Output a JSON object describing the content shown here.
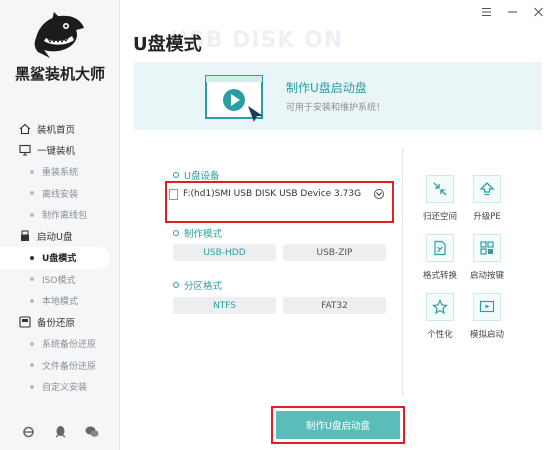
{
  "brand": {
    "name": "黑鲨装机大师"
  },
  "window": {
    "watermark": "USB DISK ON"
  },
  "sidebar": {
    "items": [
      {
        "label": "装机首页",
        "icon": "home-icon",
        "level": "main"
      },
      {
        "label": "一键装机",
        "icon": "monitor-icon",
        "level": "main"
      },
      {
        "label": "重装系统",
        "level": "sub"
      },
      {
        "label": "离线安装",
        "level": "sub"
      },
      {
        "label": "制作离线包",
        "level": "sub"
      },
      {
        "label": "启动U盘",
        "icon": "usb-icon",
        "level": "main"
      },
      {
        "label": "U盘模式",
        "level": "sub",
        "active": true
      },
      {
        "label": "ISO模式",
        "level": "sub"
      },
      {
        "label": "本地模式",
        "level": "sub"
      },
      {
        "label": "备份还原",
        "icon": "backup-icon",
        "level": "main"
      },
      {
        "label": "系统备份还原",
        "level": "sub"
      },
      {
        "label": "文件备份还原",
        "level": "sub"
      },
      {
        "label": "自定义安装",
        "level": "sub"
      }
    ],
    "footer_icons": [
      "ie-icon",
      "qq-icon",
      "wechat-icon"
    ]
  },
  "page": {
    "title": "U盘模式"
  },
  "banner": {
    "title": "制作U盘启动盘",
    "subtitle": "可用于安装和维护系统！"
  },
  "form": {
    "device": {
      "label": "U盘设备",
      "value": "F:(hd1)SMI USB DISK USB Device 3.73G"
    },
    "mode": {
      "label": "制作模式",
      "options": [
        "USB-HDD",
        "USB-ZIP"
      ],
      "selected": "USB-HDD"
    },
    "partition": {
      "label": "分区格式",
      "options": [
        "NTFS",
        "FAT32"
      ],
      "selected": "NTFS"
    }
  },
  "tools": [
    {
      "label": "归还空间",
      "icon": "restore-space-icon"
    },
    {
      "label": "升级PE",
      "icon": "upgrade-pe-icon"
    },
    {
      "label": "格式转换",
      "icon": "format-convert-icon"
    },
    {
      "label": "启动按键",
      "icon": "boot-key-icon"
    },
    {
      "label": "个性化",
      "icon": "personalize-icon"
    },
    {
      "label": "模拟启动",
      "icon": "simulate-boot-icon"
    }
  ],
  "actions": {
    "make_label": "制作U盘启动盘"
  },
  "colors": {
    "accent": "#2a9fa3",
    "button": "#5bbdb9",
    "highlight": "#e02020",
    "banner_bg": "#e9f5f6"
  }
}
